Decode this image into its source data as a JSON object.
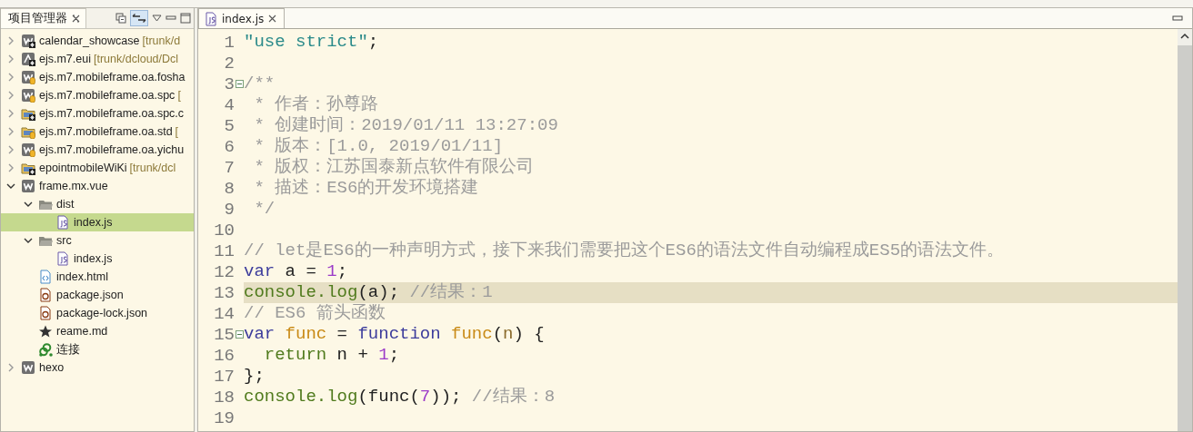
{
  "project_panel": {
    "title": "项目管理器",
    "tree": [
      {
        "label": "calendar_showcase",
        "suffix": "[trunk/d",
        "kind": "webproject",
        "modified": true,
        "expanded": false,
        "selected": false
      },
      {
        "label": "ejs.m7.eui",
        "suffix": "[trunk/dcloud/Dcl",
        "kind": "appproject",
        "modified": true,
        "expanded": false,
        "selected": false
      },
      {
        "label": "ejs.m7.mobileframe.oa.fosha",
        "kind": "webproject",
        "modified": false,
        "expanded": false,
        "selected": false
      },
      {
        "label": "ejs.m7.mobileframe.oa.spc",
        "suffix": "[",
        "kind": "webproject",
        "modified": false,
        "expanded": false,
        "selected": false
      },
      {
        "label": "ejs.m7.mobileframe.oa.spc.c",
        "kind": "folderproject",
        "modified": true,
        "expanded": false,
        "selected": false
      },
      {
        "label": "ejs.m7.mobileframe.oa.std",
        "suffix": "[",
        "kind": "folderproject",
        "modified": false,
        "expanded": false,
        "selected": false
      },
      {
        "label": "ejs.m7.mobileframe.oa.yichu",
        "kind": "webproject",
        "modified": false,
        "expanded": false,
        "selected": false
      },
      {
        "label": "epointmobileWiKi",
        "suffix": "[trunk/dcl",
        "kind": "folderproject",
        "modified": true,
        "expanded": false,
        "selected": false
      },
      {
        "label": "frame.mx.vue",
        "kind": "webproject",
        "expanded": true,
        "selected": false,
        "children": [
          {
            "label": "dist",
            "kind": "folder",
            "expanded": true,
            "selected": false,
            "children": [
              {
                "label": "index.js",
                "kind": "js",
                "selected": true
              }
            ]
          },
          {
            "label": "src",
            "kind": "folder",
            "expanded": true,
            "selected": false,
            "children": [
              {
                "label": "index.js",
                "kind": "js",
                "selected": false
              }
            ]
          },
          {
            "label": "index.html",
            "kind": "html",
            "selected": false
          },
          {
            "label": "package.json",
            "kind": "json",
            "selected": false
          },
          {
            "label": "package-lock.json",
            "kind": "json",
            "selected": false
          },
          {
            "label": "reame.md",
            "kind": "star",
            "selected": false
          },
          {
            "label": "连接",
            "kind": "link",
            "selected": false
          }
        ]
      },
      {
        "label": "hexo",
        "kind": "webproject",
        "expanded": false,
        "selected": false
      }
    ]
  },
  "editor": {
    "tabs": [
      {
        "label": "index.js",
        "selected": true
      }
    ],
    "lines": [
      {
        "number": "1",
        "tokens": [
          {
            "kind": "string",
            "text": "\"use strict\""
          },
          {
            "kind": "plain",
            "text": ";"
          }
        ]
      },
      {
        "number": "2"
      },
      {
        "number": "3",
        "fold": true,
        "tokens": [
          {
            "kind": "doc",
            "text": "/**"
          }
        ]
      },
      {
        "number": "4",
        "tokens": [
          {
            "kind": "doc",
            "text": " * 作者：孙尊路"
          }
        ]
      },
      {
        "number": "5",
        "tokens": [
          {
            "kind": "doc",
            "text": " * 创建时间：2019/01/11 13:27:09"
          }
        ]
      },
      {
        "number": "6",
        "tokens": [
          {
            "kind": "doc",
            "text": " * 版本：[1.0, 2019/01/11]"
          }
        ]
      },
      {
        "number": "7",
        "tokens": [
          {
            "kind": "doc",
            "text": " * 版权：江苏国泰新点软件有限公司"
          }
        ]
      },
      {
        "number": "8",
        "tokens": [
          {
            "kind": "doc",
            "text": " * 描述：ES6的开发环境搭建"
          }
        ]
      },
      {
        "number": "9",
        "tokens": [
          {
            "kind": "doc",
            "text": " */"
          }
        ]
      },
      {
        "number": "10"
      },
      {
        "number": "11",
        "tokens": [
          {
            "kind": "comment",
            "text": "// let是ES6的一种声明方式，接下来我们需要把这个ES6的语法文件自动编程成ES5的语法文件。"
          }
        ]
      },
      {
        "number": "12",
        "tokens": [
          {
            "kind": "keyword",
            "text": "var"
          },
          {
            "kind": "plain",
            "text": " a = "
          },
          {
            "kind": "number",
            "text": "1"
          },
          {
            "kind": "plain",
            "text": ";"
          }
        ]
      },
      {
        "number": "13",
        "current": true,
        "tokens": [
          {
            "kind": "call",
            "text": "console.log"
          },
          {
            "kind": "plain",
            "text": "(a); "
          },
          {
            "kind": "comment",
            "text": "//结果：1"
          }
        ]
      },
      {
        "number": "14",
        "tokens": [
          {
            "kind": "comment",
            "text": "// ES6 箭头函数"
          }
        ]
      },
      {
        "number": "15",
        "fold": true,
        "tokens": [
          {
            "kind": "keyword",
            "text": "var "
          },
          {
            "kind": "name",
            "text": "func"
          },
          {
            "kind": "plain",
            "text": " = "
          },
          {
            "kind": "keyword",
            "text": "function "
          },
          {
            "kind": "name",
            "text": "func"
          },
          {
            "kind": "plain",
            "text": "("
          },
          {
            "kind": "param",
            "text": "n"
          },
          {
            "kind": "plain",
            "text": ") {"
          }
        ]
      },
      {
        "number": "16",
        "tokens": [
          {
            "kind": "call",
            "text": "  return"
          },
          {
            "kind": "plain",
            "text": " n + "
          },
          {
            "kind": "number",
            "text": "1"
          },
          {
            "kind": "plain",
            "text": ";"
          }
        ]
      },
      {
        "number": "17",
        "tokens": [
          {
            "kind": "plain",
            "text": "};"
          }
        ]
      },
      {
        "number": "18",
        "tokens": [
          {
            "kind": "call",
            "text": "console.log"
          },
          {
            "kind": "plain",
            "text": "(func("
          },
          {
            "kind": "number",
            "text": "7"
          },
          {
            "kind": "plain",
            "text": ")); "
          },
          {
            "kind": "comment",
            "text": "//结果：8"
          }
        ]
      },
      {
        "number": "19"
      }
    ]
  }
}
